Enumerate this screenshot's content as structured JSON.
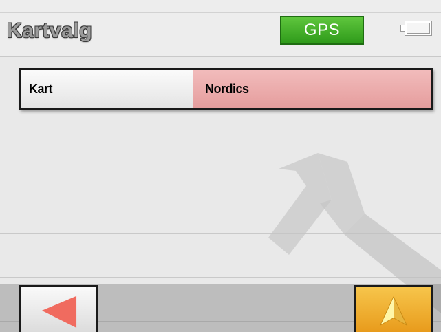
{
  "header": {
    "title": "Kartvalg",
    "gps_label": "GPS",
    "battery_icon": "battery-icon"
  },
  "settings": [
    {
      "label": "Kart",
      "value": "Nordics"
    }
  ],
  "footer": {
    "back_icon": "back-arrow-icon",
    "navigate_icon": "navigation-arrow-icon"
  },
  "colors": {
    "gps_badge": "#3aa722",
    "value_cell": "#e8a8a8",
    "nav_button": "#f0b030",
    "back_arrow": "#f06b5f"
  }
}
